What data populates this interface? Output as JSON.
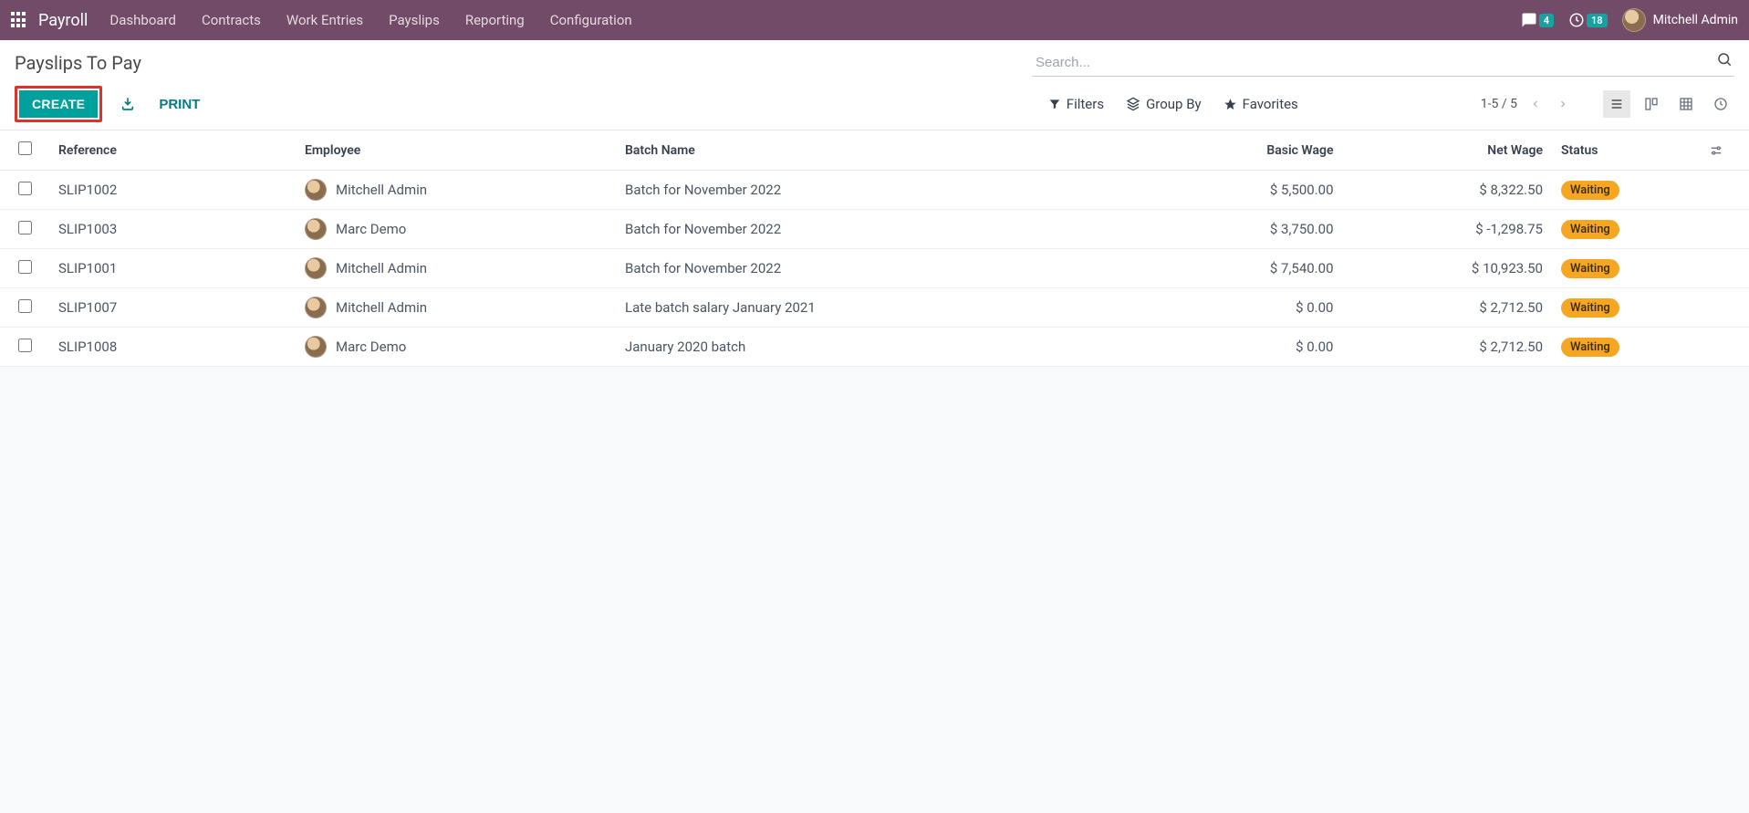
{
  "nav": {
    "app_name": "Payroll",
    "items": [
      "Dashboard",
      "Contracts",
      "Work Entries",
      "Payslips",
      "Reporting",
      "Configuration"
    ],
    "msg_count": "4",
    "activity_count": "18",
    "user_name": "Mitchell Admin"
  },
  "cp": {
    "title": "Payslips To Pay",
    "search_placeholder": "Search...",
    "create_label": "CREATE",
    "print_label": "PRINT",
    "filters_label": "Filters",
    "groupby_label": "Group By",
    "favorites_label": "Favorites",
    "pager": "1-5 / 5"
  },
  "columns": {
    "reference": "Reference",
    "employee": "Employee",
    "batch": "Batch Name",
    "basic": "Basic Wage",
    "net": "Net Wage",
    "status": "Status"
  },
  "rows": [
    {
      "reference": "SLIP1002",
      "employee": "Mitchell Admin",
      "batch": "Batch for November 2022",
      "basic": "$ 5,500.00",
      "net": "$ 8,322.50",
      "status": "Waiting"
    },
    {
      "reference": "SLIP1003",
      "employee": "Marc Demo",
      "batch": "Batch for November 2022",
      "basic": "$ 3,750.00",
      "net": "$ -1,298.75",
      "status": "Waiting"
    },
    {
      "reference": "SLIP1001",
      "employee": "Mitchell Admin",
      "batch": "Batch for November 2022",
      "basic": "$ 7,540.00",
      "net": "$ 10,923.50",
      "status": "Waiting"
    },
    {
      "reference": "SLIP1007",
      "employee": "Mitchell Admin",
      "batch": "Late batch salary January 2021",
      "basic": "$ 0.00",
      "net": "$ 2,712.50",
      "status": "Waiting"
    },
    {
      "reference": "SLIP1008",
      "employee": "Marc Demo",
      "batch": "January 2020 batch",
      "basic": "$ 0.00",
      "net": "$ 2,712.50",
      "status": "Waiting"
    }
  ]
}
